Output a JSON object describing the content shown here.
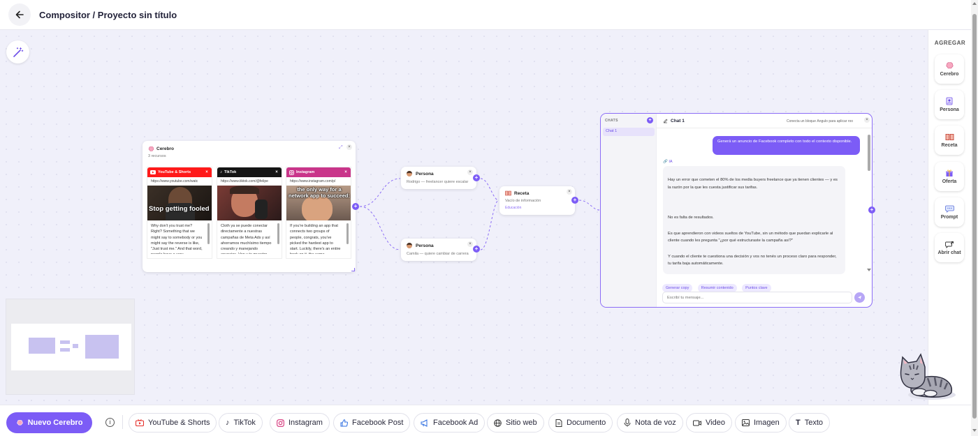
{
  "header": {
    "title": "Compositor / Proyecto sin título"
  },
  "sidebar": {
    "title": "AGREGAR",
    "items": [
      {
        "label": "Cerebro",
        "icon": "brain-icon"
      },
      {
        "label": "Persona",
        "icon": "persona-icon"
      },
      {
        "label": "Receta",
        "icon": "recipe-book-icon"
      },
      {
        "label": "Oferta",
        "icon": "gift-icon"
      },
      {
        "label": "Prompt",
        "icon": "chat-bubble-icon"
      },
      {
        "label": "Abrir chat",
        "icon": "open-chat-icon"
      }
    ]
  },
  "brain_node": {
    "title": "Cerebro",
    "subtitle": "3 recursos",
    "sources": [
      {
        "name": "YouTube & Shorts",
        "color": "#ff1a1a",
        "url": "https://www.youtube.com/watc",
        "thumb_text": "Stop getting fooled",
        "text": "Why don't you trust me? Right? Something that we might say to somebody or you might say the reverse is like, \"Just trust me.\" And that word, people have a very"
      },
      {
        "name": "TikTok",
        "color": "#151515",
        "url": "https://www.tiktok.com/@felipe",
        "thumb_text": "",
        "text": "Cloth ya se puede conectar directamente a nuestras campañas de Meta Ads y así ahorramos muchísimo tiempo creando y manejando anuncios. Ven y te muestro"
      },
      {
        "name": "Instagram",
        "color": "#c9358a",
        "url": "https://www.instagram.com/p/",
        "thumb_text": "the only way for a network app to succeed:",
        "text": "If you're building an app that connects two groups of people, congrats, you've picked the hardest app to start. Luckily, there's an entire book on it, the same"
      }
    ]
  },
  "persona_nodes": [
    {
      "title": "Persona",
      "subtitle": "Rodrigo — freelancer quiere escalar"
    },
    {
      "title": "Persona",
      "subtitle": "Camila — quiere cambiar de carrera"
    }
  ],
  "recipe_node": {
    "title": "Receta",
    "subtitle": "Vacío de información",
    "tag": "Educación"
  },
  "chat_node": {
    "chats_label": "CHATS",
    "chats": [
      "Chat 1"
    ],
    "title": "Chat 1",
    "hint": "Conecta un bloque Ángulo para aplicar roo",
    "user_message": "Generá un anuncio de Facebook completo con todo el contexto disponible.",
    "ai_label": "IA",
    "ai_paragraphs": [
      "Hay un error que cometen el 80% de los media buyers freelance que ya tienen clientes — y es la razón por la que les cuesta justificar sus tarifas.",
      "No es falta de resultados.",
      "Es que aprendieron con videos sueltos de YouTube, sin un método que puedan explicarle al cliente cuando les pregunta \"¿por qué estructuraste la campaña así?\"",
      "Y cuando el cliente te cuestiona una decisión y vos no tenés un proceso claro para responder, tu tarifa baja automáticamente."
    ],
    "suggestions": [
      "Generar copy",
      "Resumir contenido",
      "Puntos clave"
    ],
    "input_placeholder": "Escribí tu mensaje..."
  },
  "toolbar": {
    "primary": "Nuevo Cerebro",
    "items": [
      {
        "label": "YouTube & Shorts",
        "icon": "youtube-icon"
      },
      {
        "label": "TikTok",
        "icon": "tiktok-icon"
      },
      {
        "label": "Instagram",
        "icon": "instagram-icon"
      },
      {
        "label": "Facebook Post",
        "icon": "thumbs-up-icon"
      },
      {
        "label": "Facebook Ad",
        "icon": "megaphone-icon"
      },
      {
        "label": "Sitio web",
        "icon": "globe-icon"
      },
      {
        "label": "Documento",
        "icon": "document-icon"
      },
      {
        "label": "Nota de voz",
        "icon": "microphone-icon"
      },
      {
        "label": "Video",
        "icon": "video-icon"
      },
      {
        "label": "Imagen",
        "icon": "image-icon"
      },
      {
        "label": "Texto",
        "icon": "text-icon"
      }
    ]
  },
  "colors": {
    "accent": "#7c5cf6",
    "youtube": "#ff1a1a",
    "tiktok": "#151515",
    "instagram": "#c9358a"
  }
}
